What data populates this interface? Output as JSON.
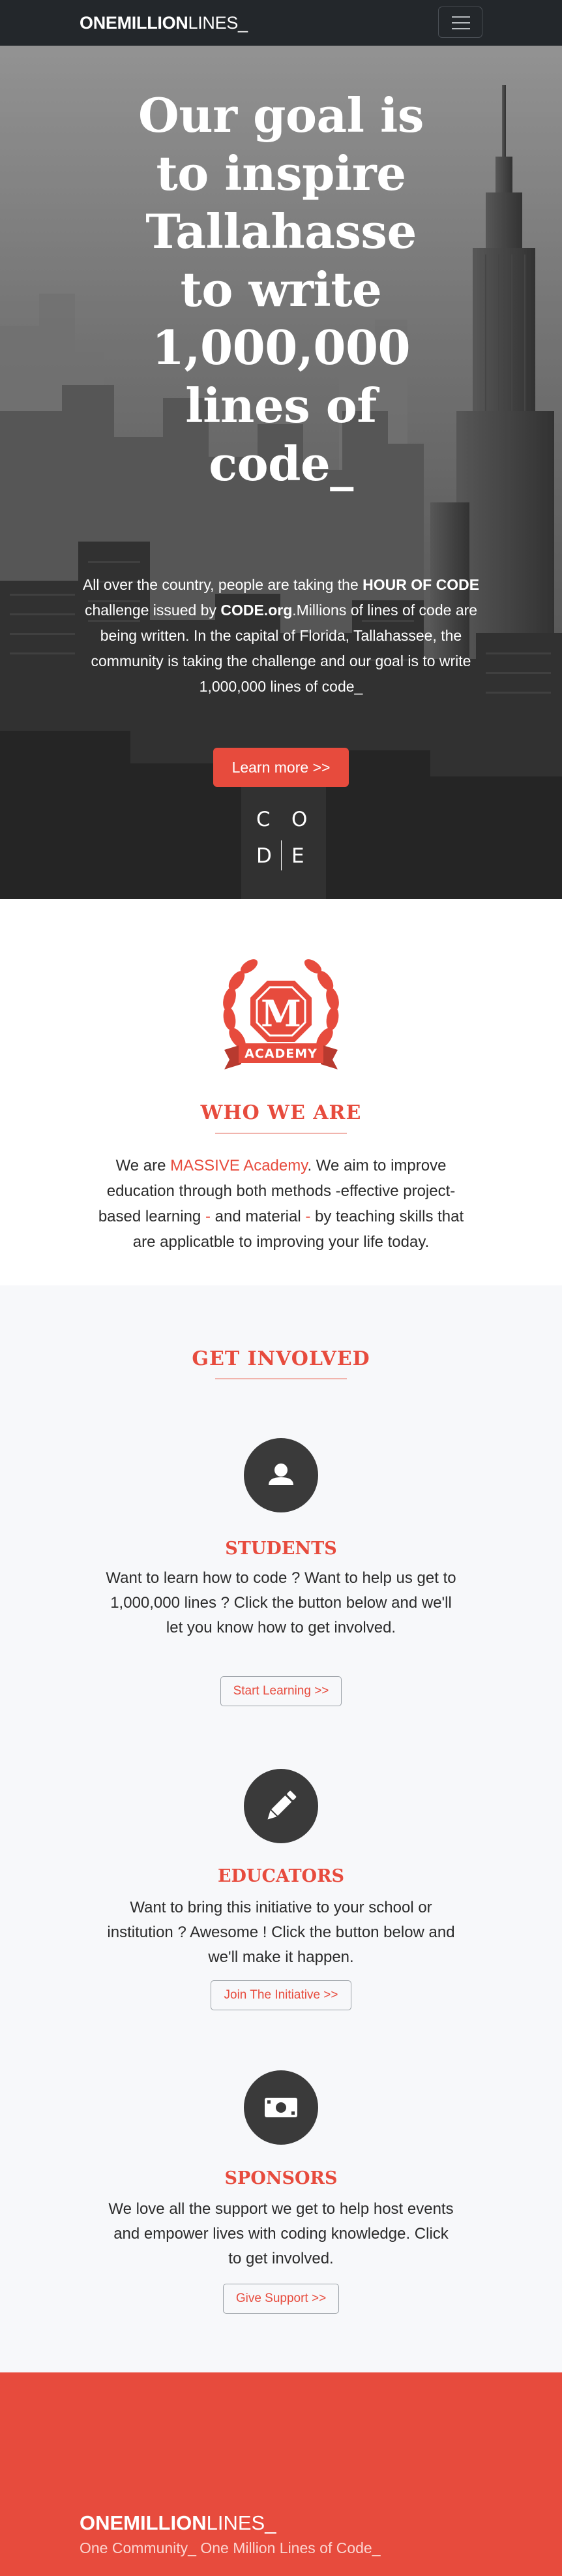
{
  "nav": {
    "brand_bold": "ONEMILLION",
    "brand_light": "LINES_",
    "menu_icon": "hamburger-icon"
  },
  "hero": {
    "title": "Our goal is to inspire Tallahasse to write 1,000,000 lines of code_",
    "text_1": "All over the country, people are taking the ",
    "text_bold_1": "HOUR OF CODE",
    "text_2": " challenge issued by ",
    "text_bold_2": "CODE.org",
    "text_3": ".Millions of lines of code are being written. In the capital of Florida, Tallahassee, the community is taking the challenge and our goal is to write 1,000,000 lines of code_",
    "button_label": "Learn more >>",
    "logo_letters": [
      "C",
      "O",
      "D",
      "E"
    ]
  },
  "who": {
    "badge_letter": "M",
    "badge_label": "ACADEMY",
    "title": "WHO WE ARE",
    "text_1": "We are ",
    "text_accent_1": "MASSIVE Academy",
    "text_2": ". We aim to improve education through both methods -effective project-based learning ",
    "text_accent_2": "-",
    "text_3": " and material ",
    "text_accent_3": "-",
    "text_4": " by teaching skills that are applicatble to improving your life today."
  },
  "involved": {
    "title": "GET INVOLVED",
    "cards": [
      {
        "icon": "user-icon",
        "title": "STUDENTS",
        "text": "Want to learn how to code ? Want to help us get to 1,000,000 lines ? Click the button below and we'll let you know how to get involved.",
        "button": "Start Learning >>"
      },
      {
        "icon": "pencil-icon",
        "title": "EDUCATORS",
        "text": "Want to bring this initiative to your school or institution ? Awesome ! Click the button below and we'll make it happen.",
        "button": "Join The Initiative >>"
      },
      {
        "icon": "money-icon",
        "title": "SPONSORS",
        "text": "We love all the support we get to help host events and empower lives with coding knowledge. Click to get involved.",
        "button": "Give Support >>"
      }
    ]
  },
  "footer": {
    "brand_bold": "ONEMILLION",
    "brand_light": "LINES_",
    "tagline": "One Community_ One Million Lines of Code_"
  },
  "colors": {
    "accent": "#e74b3d",
    "navbar": "#23272b",
    "icon_circle": "#3a3a3a"
  }
}
